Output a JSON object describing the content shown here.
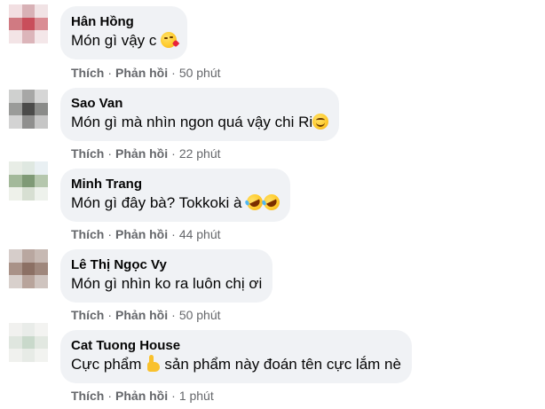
{
  "comments": [
    {
      "author": "Hân Hồng",
      "text": "Món gì vậy c",
      "emoji": "kiss-face",
      "like_label": "Thích",
      "reply_label": "Phản hồi",
      "time": "50 phút",
      "avatar_colors": [
        "#f2dfe2",
        "#d8b1b6",
        "#f1e3e5",
        "#d07a82",
        "#c94e5b",
        "#da8d94",
        "#f3e4e6",
        "#dcb5ba",
        "#f4e7e9"
      ]
    },
    {
      "author": "Sao Van",
      "text": "Món gì mà nhìn ngon quá vậy chi Ri",
      "emoji": "smiling-face",
      "like_label": "Thích",
      "reply_label": "Phản hồi",
      "time": "22 phút",
      "avatar_colors": [
        "#cfd0cf",
        "#a7a7a6",
        "#d6d6d6",
        "#9a9b99",
        "#4b4b4a",
        "#8a8b89",
        "#d3d3d3",
        "#8f8f8e",
        "#c6c6c6"
      ]
    },
    {
      "author": "Minh Trang",
      "text": "Món gì đây bà? Tokkoki à",
      "emoji": "rolling-laughing-face",
      "like_label": "Thích",
      "reply_label": "Phản hồi",
      "time": "44 phút",
      "avatar_colors": [
        "#e8ede6",
        "#dfe8e1",
        "#e9f0f3",
        "#a3b99a",
        "#7f9a76",
        "#b5c7ad",
        "#eef1ea",
        "#d7dfd2",
        "#eef2ec"
      ]
    },
    {
      "author": "Lê Thị Ngọc Vy",
      "text": "Món gì nhìn ko ra luôn chị ơi",
      "emoji": "",
      "like_label": "Thích",
      "reply_label": "Phản hồi",
      "time": "50 phút",
      "avatar_colors": [
        "#d6cdca",
        "#b9a7a0",
        "#c7b9b3",
        "#a99288",
        "#8c7064",
        "#9f877c",
        "#d8d0cc",
        "#b8a49b",
        "#cfc4bf"
      ]
    },
    {
      "author": "Cat Tuong House",
      "text_before": "Cực phẩm",
      "text_after": "sản phẩm này đoán tên cực lắm nè",
      "emoji": "thumbs-up",
      "like_label": "Thích",
      "reply_label": "Phản hồi",
      "time": "1 phút",
      "avatar_colors": [
        "#f1f1ef",
        "#e9ece9",
        "#f3f3f1",
        "#dfe6df",
        "#c9d9cb",
        "#e2e8e1",
        "#f0f1ee",
        "#e7ebe6",
        "#f2f3f0"
      ]
    }
  ]
}
